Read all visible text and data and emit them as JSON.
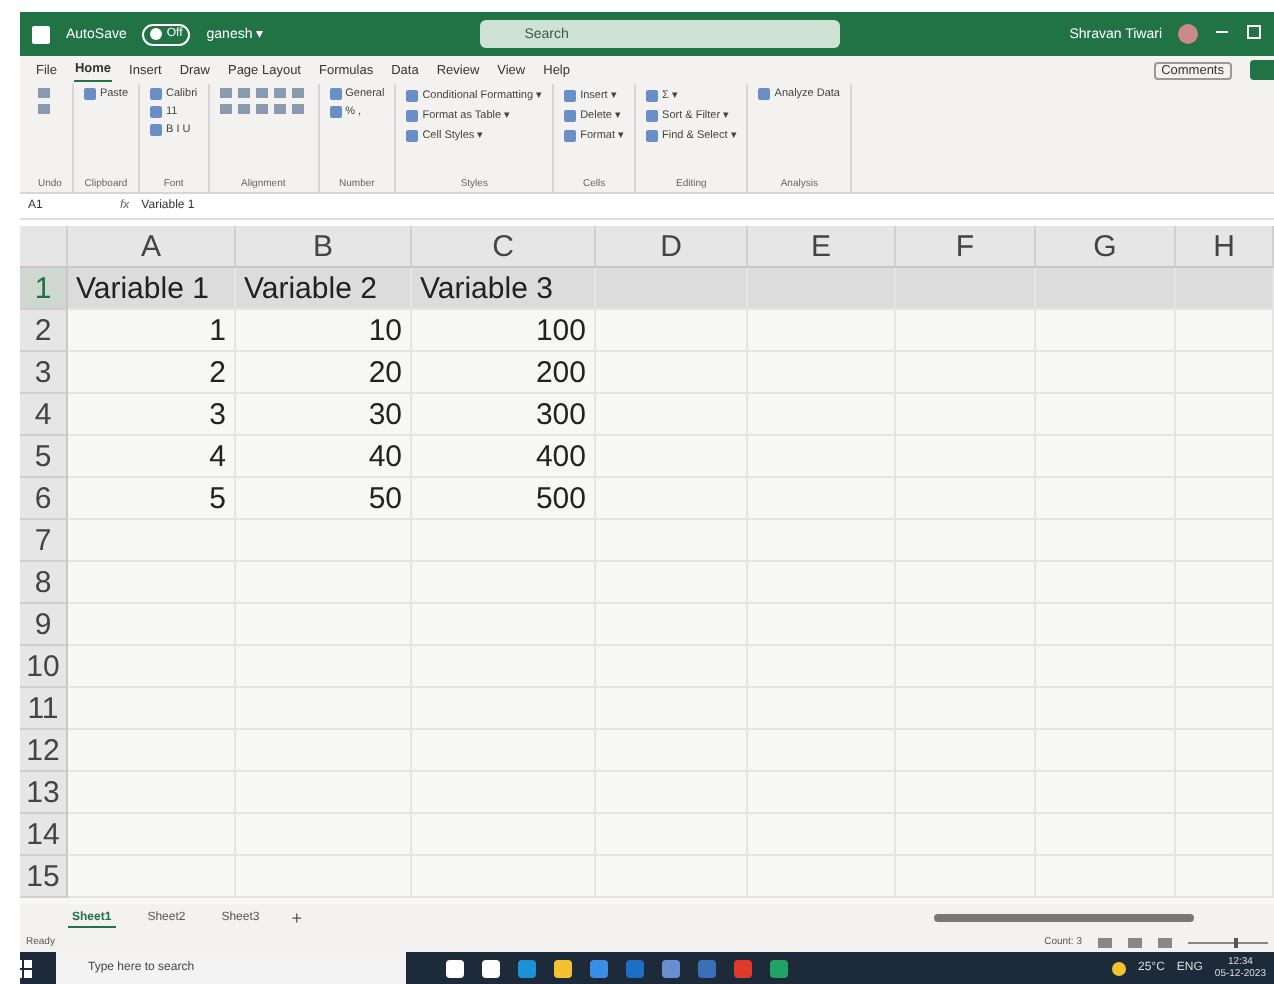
{
  "titlebar": {
    "autosave_label": "AutoSave",
    "autosave_on": false,
    "autosave_state": "Off",
    "file_name": "ganesh ▾",
    "search_placeholder": "Search",
    "user": "Shravan Tiwari"
  },
  "menu": {
    "tabs": [
      {
        "label": "File",
        "selected": false
      },
      {
        "label": "Home",
        "selected": true
      },
      {
        "label": "Insert",
        "selected": false
      },
      {
        "label": "Draw",
        "selected": false
      },
      {
        "label": "Page Layout",
        "selected": false
      },
      {
        "label": "Formulas",
        "selected": false
      },
      {
        "label": "Data",
        "selected": false
      },
      {
        "label": "Review",
        "selected": false
      },
      {
        "label": "View",
        "selected": false
      },
      {
        "label": "Help",
        "selected": false
      }
    ],
    "comments": "Comments"
  },
  "ribbon": [
    {
      "label": "Undo"
    },
    {
      "label": "Clipboard",
      "items": [
        "Paste"
      ]
    },
    {
      "label": "Font",
      "items": [
        "Calibri",
        "11",
        "B  I  U"
      ]
    },
    {
      "label": "Alignment"
    },
    {
      "label": "Number",
      "items": [
        "General",
        "%  ,"
      ]
    },
    {
      "label": "Styles",
      "items": [
        "Conditional Formatting ▾",
        "Format as Table ▾",
        "Cell Styles ▾"
      ]
    },
    {
      "label": "Cells",
      "items": [
        "Insert ▾",
        "Delete ▾",
        "Format ▾"
      ]
    },
    {
      "label": "Editing",
      "items": [
        "Σ ▾",
        "Sort & Filter ▾",
        "Find & Select ▾"
      ]
    },
    {
      "label": "Analysis",
      "items": [
        "Analyze Data"
      ]
    }
  ],
  "formula_bar": {
    "name_box": "A1",
    "fx": "fx",
    "value": "Variable 1"
  },
  "sheet": {
    "columns": [
      "A",
      "B",
      "C",
      "D",
      "E",
      "F",
      "G",
      "H"
    ],
    "rows": [
      {
        "label": "1",
        "selected": true,
        "kind": "text",
        "cells": [
          "Variable 1",
          "Variable 2",
          "Variable 3"
        ]
      },
      {
        "label": "2",
        "selected": false,
        "kind": "number",
        "cells": [
          "1",
          "10",
          "100"
        ]
      },
      {
        "label": "3",
        "selected": false,
        "kind": "number",
        "cells": [
          "2",
          "20",
          "200"
        ]
      },
      {
        "label": "4",
        "selected": false,
        "kind": "number",
        "cells": [
          "3",
          "30",
          "300"
        ]
      },
      {
        "label": "5",
        "selected": false,
        "kind": "number",
        "cells": [
          "4",
          "40",
          "400"
        ]
      },
      {
        "label": "6",
        "selected": false,
        "kind": "number",
        "cells": [
          "5",
          "50",
          "500"
        ]
      },
      {
        "label": "7",
        "selected": false,
        "kind": "number",
        "cells": []
      },
      {
        "label": "8",
        "selected": false,
        "kind": "number",
        "cells": []
      },
      {
        "label": "9",
        "selected": false,
        "kind": "number",
        "cells": []
      },
      {
        "label": "10",
        "selected": false,
        "kind": "number",
        "cells": []
      },
      {
        "label": "11",
        "selected": false,
        "kind": "number",
        "cells": []
      },
      {
        "label": "12",
        "selected": false,
        "kind": "number",
        "cells": []
      },
      {
        "label": "13",
        "selected": false,
        "kind": "number",
        "cells": []
      },
      {
        "label": "14",
        "selected": false,
        "kind": "number",
        "cells": []
      },
      {
        "label": "15",
        "selected": false,
        "kind": "number",
        "cells": []
      }
    ]
  },
  "sheet_tabs": [
    {
      "label": "Sheet1",
      "selected": true
    },
    {
      "label": "Sheet2",
      "selected": false
    },
    {
      "label": "Sheet3",
      "selected": false
    }
  ],
  "add_sheet": "+",
  "status_bar": {
    "status": "Ready",
    "count": "Count: 3",
    "zoom": {
      "level": 0.6
    }
  },
  "taskbar": {
    "search_placeholder": "Type here to search",
    "apps": [
      {
        "color": "#ffffff"
      },
      {
        "color": "#ffffff"
      },
      {
        "color": "#1e90d6"
      },
      {
        "color": "#f2c230"
      },
      {
        "color": "#3a8ee6"
      },
      {
        "color": "#1c6fc4"
      },
      {
        "color": "#6a8fd0"
      },
      {
        "color": "#3b6fb8"
      },
      {
        "color": "#e03a2a"
      },
      {
        "color": "#21a366"
      }
    ],
    "temperature": "25°C",
    "language": "ENG",
    "time": "12:34",
    "date": "05-12-2023"
  }
}
